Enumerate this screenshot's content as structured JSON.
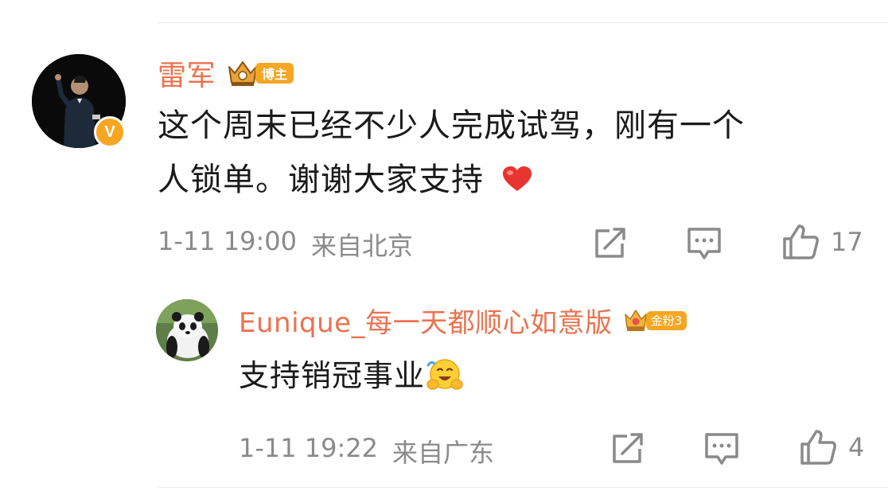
{
  "comment": {
    "author": "雷军",
    "author_badge": "博主",
    "verified_badge": "V",
    "text_line1": "这个周末已经不少人完成试驾，刚有一个",
    "text_line2": "人锁单。谢谢大家支持",
    "date": "1-11 19:00",
    "location": "来自北京",
    "like_count": "17",
    "icons": [
      "share-icon",
      "comment-icon",
      "like-icon",
      "heart-emoji",
      "crown-icon"
    ]
  },
  "reply": {
    "author": "Eunique_每一天都顺心如意版",
    "fan_badge": "金粉3",
    "text": "支持销冠事业",
    "date": "1-11 19:22",
    "location": "来自广东",
    "like_count": "4",
    "icons": [
      "share-icon",
      "comment-icon",
      "like-icon",
      "hug-emoji",
      "gold-crown-icon"
    ]
  },
  "colors": {
    "name": "#eb7350",
    "meta": "#8a8a8a",
    "badge": "#f5a623",
    "text": "#1a1a1a"
  }
}
